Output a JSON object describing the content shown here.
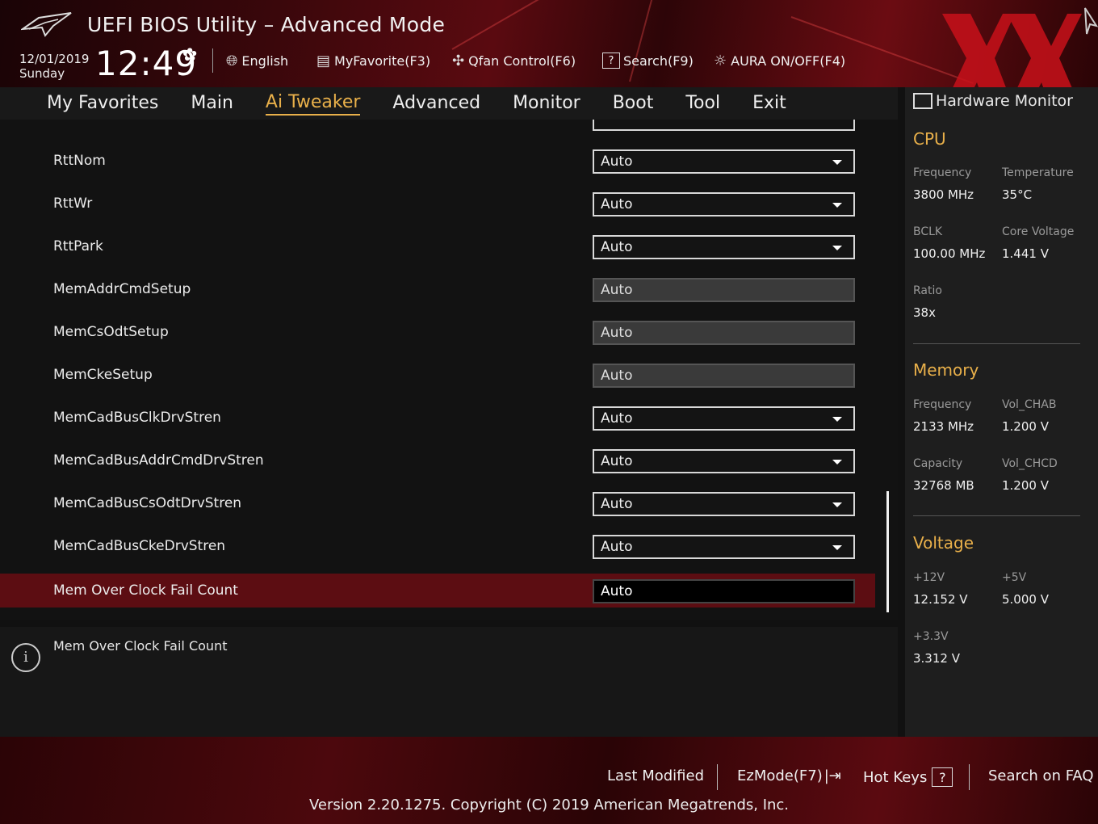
{
  "header": {
    "title": "UEFI BIOS Utility – Advanced Mode",
    "date": "12/01/2019",
    "day": "Sunday",
    "time": "12:49",
    "tools": {
      "language": "English",
      "favorite": "MyFavorite(F3)",
      "qfan": "Qfan Control(F6)",
      "search": "Search(F9)",
      "aura": "AURA ON/OFF(F4)"
    }
  },
  "nav": {
    "tabs": [
      "My Favorites",
      "Main",
      "Ai Tweaker",
      "Advanced",
      "Monitor",
      "Boot",
      "Tool",
      "Exit"
    ],
    "active": "Ai Tweaker"
  },
  "settings": [
    {
      "label": "RttNom",
      "value": "Auto",
      "type": "dropdown"
    },
    {
      "label": "RttWr",
      "value": "Auto",
      "type": "dropdown"
    },
    {
      "label": "RttPark",
      "value": "Auto",
      "type": "dropdown"
    },
    {
      "label": "MemAddrCmdSetup",
      "value": "Auto",
      "type": "disabled"
    },
    {
      "label": "MemCsOdtSetup",
      "value": "Auto",
      "type": "disabled"
    },
    {
      "label": "MemCkeSetup",
      "value": "Auto",
      "type": "disabled"
    },
    {
      "label": "MemCadBusClkDrvStren",
      "value": "Auto",
      "type": "dropdown"
    },
    {
      "label": "MemCadBusAddrCmdDrvStren",
      "value": "Auto",
      "type": "dropdown"
    },
    {
      "label": "MemCadBusCsOdtDrvStren",
      "value": "Auto",
      "type": "dropdown"
    },
    {
      "label": "MemCadBusCkeDrvStren",
      "value": "Auto",
      "type": "dropdown"
    },
    {
      "label": "Mem Over Clock Fail Count",
      "value": "Auto",
      "type": "input"
    }
  ],
  "info": {
    "text": "Mem Over Clock Fail Count"
  },
  "hw_monitor": {
    "title": "Hardware Monitor",
    "cpu": {
      "heading": "CPU",
      "frequency_label": "Frequency",
      "frequency": "3800 MHz",
      "temperature_label": "Temperature",
      "temperature": "35°C",
      "bclk_label": "BCLK",
      "bclk": "100.00 MHz",
      "core_voltage_label": "Core Voltage",
      "core_voltage": "1.441 V",
      "ratio_label": "Ratio",
      "ratio": "38x"
    },
    "memory": {
      "heading": "Memory",
      "frequency_label": "Frequency",
      "frequency": "2133 MHz",
      "vol_chab_label": "Vol_CHAB",
      "vol_chab": "1.200 V",
      "capacity_label": "Capacity",
      "capacity": "32768 MB",
      "vol_chcd_label": "Vol_CHCD",
      "vol_chcd": "1.200 V"
    },
    "voltage": {
      "heading": "Voltage",
      "v12_label": "+12V",
      "v12": "12.152 V",
      "v5_label": "+5V",
      "v5": "5.000 V",
      "v33_label": "+3.3V",
      "v33": "3.312 V"
    }
  },
  "footer": {
    "last_modified": "Last Modified",
    "ezmode": "EzMode(F7)",
    "hotkeys": "Hot Keys",
    "faq": "Search on FAQ",
    "version": "Version 2.20.1275. Copyright (C) 2019 American Megatrends, Inc."
  },
  "colors": {
    "accent": "#e9b04a",
    "selected_row": "#5c0d12",
    "header_red": "#5a0a10"
  }
}
